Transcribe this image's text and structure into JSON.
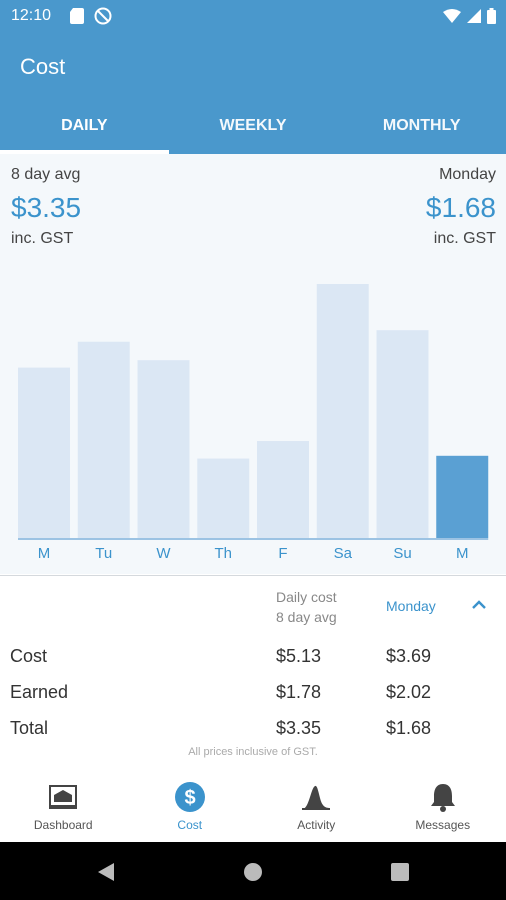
{
  "status_bar": {
    "time": "12:10"
  },
  "app_bar": {
    "title": "Cost"
  },
  "tabs": [
    {
      "label": "DAILY",
      "active": true
    },
    {
      "label": "WEEKLY",
      "active": false
    },
    {
      "label": "MONTHLY",
      "active": false
    }
  ],
  "summary": {
    "avg_caption": "8 day avg",
    "avg_value": "$3.35",
    "avg_gst": "inc. GST",
    "day_caption": "Monday",
    "day_value": "$1.68",
    "day_gst": "inc. GST"
  },
  "chart_data": {
    "type": "bar",
    "categories": [
      "M",
      "Tu",
      "W",
      "Th",
      "F",
      "Sa",
      "Su",
      "M"
    ],
    "values": [
      3.69,
      4.25,
      3.85,
      1.72,
      2.1,
      5.5,
      4.5,
      1.78
    ],
    "highlight_index": 7,
    "colors": {
      "bar": "#dbe7f4",
      "highlight": "#5aa0d3",
      "axis": "#9cc3e3",
      "label": "#3b93cc"
    }
  },
  "table": {
    "header_daily_line1": "Daily cost",
    "header_daily_line2": "8 day avg",
    "header_monday": "Monday",
    "rows": [
      {
        "label": "Cost",
        "avg": "$5.13",
        "monday": "$3.69"
      },
      {
        "label": "Earned",
        "avg": "$1.78",
        "monday": "$2.02"
      },
      {
        "label": "Total",
        "avg": "$3.35",
        "monday": "$1.68"
      }
    ],
    "footnote": "All prices inclusive of GST."
  },
  "bottom_nav": [
    {
      "label": "Dashboard",
      "icon": "dashboard-icon",
      "active": false
    },
    {
      "label": "Cost",
      "icon": "dollar-icon",
      "active": true
    },
    {
      "label": "Activity",
      "icon": "activity-icon",
      "active": false
    },
    {
      "label": "Messages",
      "icon": "bell-icon",
      "active": false
    }
  ],
  "colors": {
    "primary": "#4a98cc",
    "accent": "#3b93cc"
  }
}
